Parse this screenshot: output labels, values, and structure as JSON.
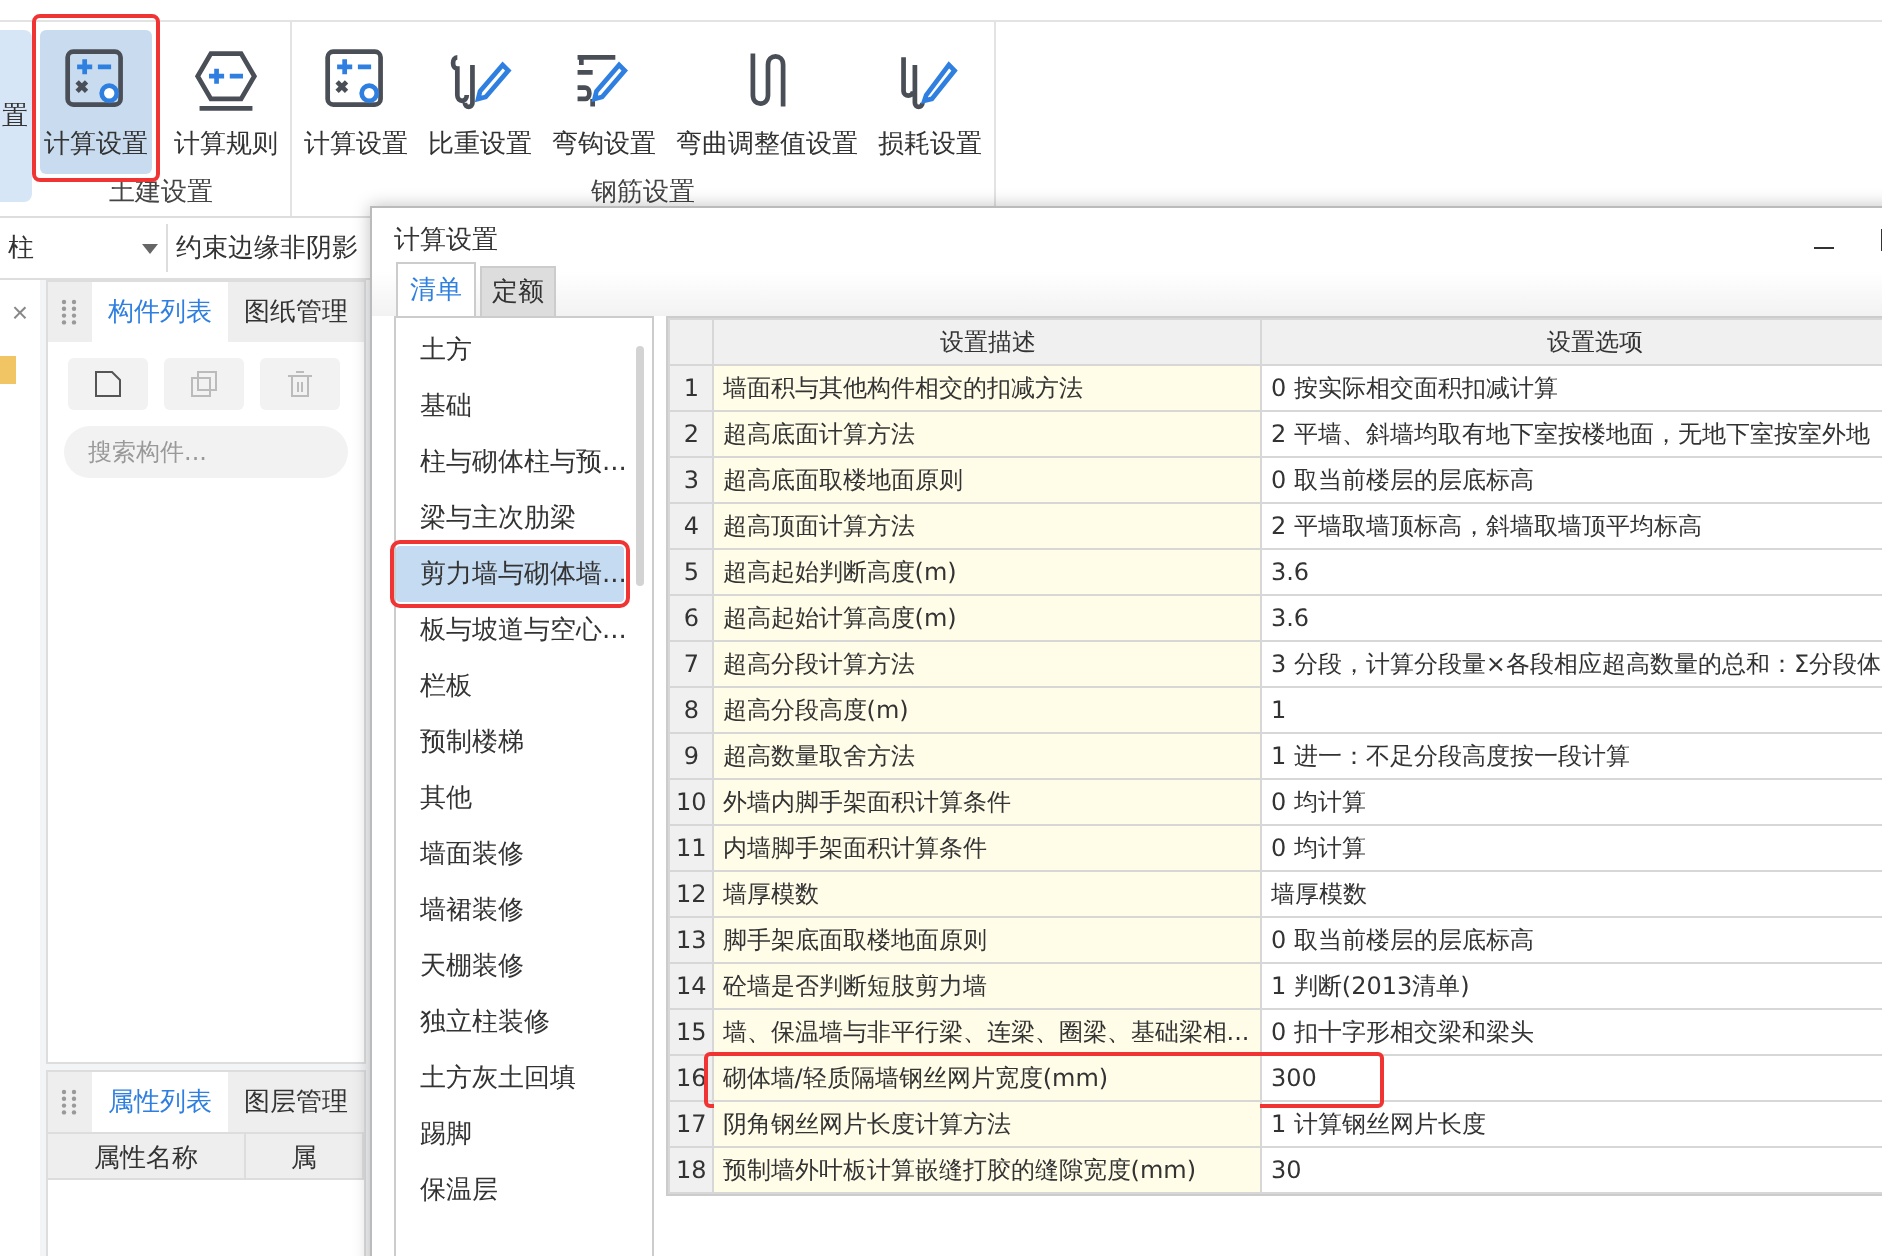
{
  "ribbon": {
    "cut_button": {
      "label": "置",
      "selected": true
    },
    "groups": [
      {
        "label": "土建设置",
        "buttons": [
          {
            "label": "计算设置",
            "kind": "calc",
            "selected": true,
            "highlighted": true
          },
          {
            "label": "计算规则",
            "kind": "rule",
            "selected": false,
            "highlighted": false
          }
        ]
      },
      {
        "label": "钢筋设置",
        "buttons": [
          {
            "label": "计算设置",
            "kind": "calc",
            "selected": false,
            "highlighted": false
          },
          {
            "label": "比重设置",
            "kind": "hook",
            "selected": false,
            "highlighted": false
          },
          {
            "label": "弯钩设置",
            "kind": "bend",
            "selected": false,
            "highlighted": false
          },
          {
            "label": "弯曲调整值设置",
            "kind": "wave",
            "selected": false,
            "highlighted": false
          },
          {
            "label": "损耗设置",
            "kind": "loss",
            "selected": false,
            "highlighted": false
          }
        ]
      }
    ]
  },
  "filters": [
    {
      "value": "柱"
    },
    {
      "value": "约束边缘非阴影"
    }
  ],
  "side_strip": {
    "close": "×"
  },
  "component_panel": {
    "tabs": [
      {
        "label": "构件列表",
        "selected": true
      },
      {
        "label": "图纸管理",
        "selected": false
      }
    ],
    "search": {
      "placeholder": "搜索构件..."
    }
  },
  "property_panel": {
    "tabs": [
      {
        "label": "属性列表",
        "selected": true
      },
      {
        "label": "图层管理",
        "selected": false
      }
    ],
    "columns": [
      "属性名称",
      "属"
    ]
  },
  "dialog": {
    "title": "计算设置",
    "tabs": [
      {
        "label": "清单",
        "selected": true
      },
      {
        "label": "定额",
        "selected": false
      }
    ],
    "categories": [
      {
        "label": "土方",
        "selected": false,
        "highlighted": false
      },
      {
        "label": "基础",
        "selected": false,
        "highlighted": false
      },
      {
        "label": "柱与砌体柱与预...",
        "selected": false,
        "highlighted": false
      },
      {
        "label": "梁与主次肋梁",
        "selected": false,
        "highlighted": false
      },
      {
        "label": "剪力墙与砌体墙...",
        "selected": true,
        "highlighted": true
      },
      {
        "label": "板与坡道与空心...",
        "selected": false,
        "highlighted": false
      },
      {
        "label": "栏板",
        "selected": false,
        "highlighted": false
      },
      {
        "label": "预制楼梯",
        "selected": false,
        "highlighted": false
      },
      {
        "label": "其他",
        "selected": false,
        "highlighted": false
      },
      {
        "label": "墙面装修",
        "selected": false,
        "highlighted": false
      },
      {
        "label": "墙裙装修",
        "selected": false,
        "highlighted": false
      },
      {
        "label": "天棚装修",
        "selected": false,
        "highlighted": false
      },
      {
        "label": "独立柱装修",
        "selected": false,
        "highlighted": false
      },
      {
        "label": "土方灰土回填",
        "selected": false,
        "highlighted": false
      },
      {
        "label": "踢脚",
        "selected": false,
        "highlighted": false
      },
      {
        "label": "保温层",
        "selected": false,
        "highlighted": false
      }
    ],
    "columns": [
      "设置描述",
      "设置选项"
    ],
    "rows": [
      {
        "index": "1",
        "description": "墙面积与其他构件相交的扣减方法",
        "option": "0 按实际相交面积扣减计算",
        "highlighted": false
      },
      {
        "index": "2",
        "description": "超高底面计算方法",
        "option": "2 平墙、斜墙均取有地下室按楼地面，无地下室按室外地",
        "highlighted": false
      },
      {
        "index": "3",
        "description": "超高底面取楼地面原则",
        "option": "0 取当前楼层的层底标高",
        "highlighted": false
      },
      {
        "index": "4",
        "description": "超高顶面计算方法",
        "option": "2 平墙取墙顶标高，斜墙取墙顶平均标高",
        "highlighted": false
      },
      {
        "index": "5",
        "description": "超高起始判断高度(m)",
        "option": "3.6",
        "highlighted": false
      },
      {
        "index": "6",
        "description": "超高起始计算高度(m)",
        "option": "3.6",
        "highlighted": false
      },
      {
        "index": "7",
        "description": "超高分段计算方法",
        "option": "3 分段，计算分段量×各段相应超高数量的总和：Σ分段体",
        "highlighted": false
      },
      {
        "index": "8",
        "description": "超高分段高度(m)",
        "option": "1",
        "highlighted": false
      },
      {
        "index": "9",
        "description": "超高数量取舍方法",
        "option": "1 进一：不足分段高度按一段计算",
        "highlighted": false
      },
      {
        "index": "10",
        "description": "外墙内脚手架面积计算条件",
        "option": "0 均计算",
        "highlighted": false
      },
      {
        "index": "11",
        "description": "内墙脚手架面积计算条件",
        "option": "0 均计算",
        "highlighted": false
      },
      {
        "index": "12",
        "description": "墙厚模数",
        "option": "墙厚模数",
        "highlighted": false
      },
      {
        "index": "13",
        "description": "脚手架底面取楼地面原则",
        "option": "0 取当前楼层的层底标高",
        "highlighted": false
      },
      {
        "index": "14",
        "description": "砼墙是否判断短肢剪力墙",
        "option": "1 判断(2013清单)",
        "highlighted": false
      },
      {
        "index": "15",
        "description": "墙、保温墙与非平行梁、连梁、圈梁、基础梁相...",
        "option": "0 扣十字形相交梁和梁头",
        "highlighted": false
      },
      {
        "index": "16",
        "description": "砌体墙/轻质隔墙钢丝网片宽度(mm)",
        "option": "300",
        "highlighted": true
      },
      {
        "index": "17",
        "description": "阴角钢丝网片长度计算方法",
        "option": "1 计算钢丝网片长度",
        "highlighted": false
      },
      {
        "index": "18",
        "description": "预制墙外叶板计算嵌缝打胶的缝隙宽度(mm)",
        "option": "30",
        "highlighted": false
      }
    ]
  }
}
